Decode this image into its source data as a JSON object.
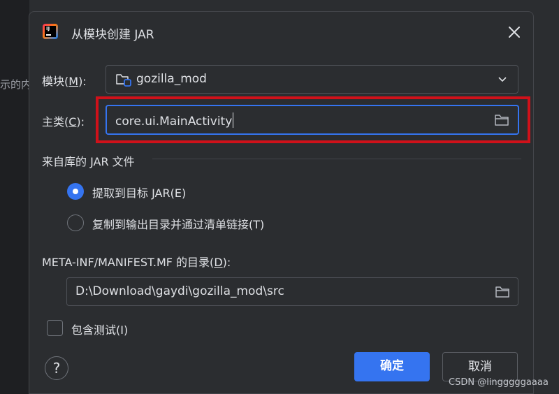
{
  "background": {
    "partial_text": "示的内"
  },
  "dialog": {
    "title": "从模块创建 JAR",
    "module_label": "模块(",
    "module_mnemonic": "M",
    "module_label_end": "):",
    "module_value": "gozilla_mod",
    "main_class_label": "主类(",
    "main_class_mnemonic": "C",
    "main_class_label_end": "):",
    "main_class_value": "core.ui.MainActivity",
    "library_section_title": "来自库的 JAR 文件",
    "radio_extract_label": "提取到目标 JAR(E)",
    "radio_copy_label": "复制到输出目录并通过清单链接(T)",
    "manifest_label": "META-INF/MANIFEST.MF 的目录(",
    "manifest_mnemonic": "D",
    "manifest_label_end": "):",
    "manifest_value": "D:\\Download\\gaydi\\gozilla_mod\\src",
    "include_tests_label": "包含测试(I)",
    "help_label": "?",
    "ok_label": "确定",
    "cancel_label": "取消"
  },
  "state": {
    "extract_selected": true,
    "include_tests_checked": false
  },
  "watermark": "CSDN @lingggggaaaa",
  "colors": {
    "accent": "#3574f0",
    "highlight": "#d0111a",
    "dialog_bg": "#2b2d30",
    "text": "#dfe1e5"
  },
  "icons": [
    "app-logo-icon",
    "close-icon",
    "module-folder-icon",
    "chevron-down-icon",
    "folder-icon"
  ]
}
